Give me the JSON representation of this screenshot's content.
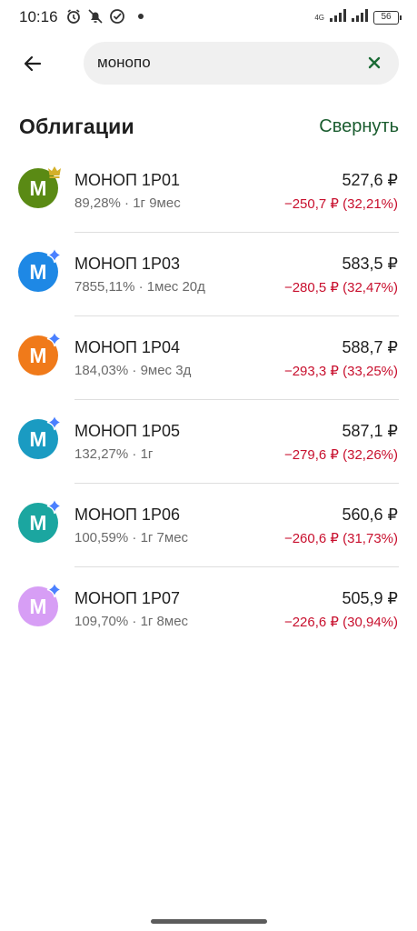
{
  "status_bar": {
    "time": "10:16",
    "network": "4G",
    "battery": "56"
  },
  "search": {
    "value": "монопо"
  },
  "section": {
    "title": "Облигации",
    "collapse_label": "Свернуть"
  },
  "bonds": [
    {
      "name": "МОНОП 1Р01",
      "yield": "89,28%",
      "term": "1г 9мес",
      "price": "527,6 ₽",
      "change": "−250,7 ₽ (32,21%)",
      "avatar_letter": "М",
      "avatar_color": "#5a8a14",
      "badge": "crown-icon",
      "badge_color": "#d4b02a"
    },
    {
      "name": "МОНОП 1Р03",
      "yield": "7855,11%",
      "term": "1мес 20д",
      "price": "583,5 ₽",
      "change": "−280,5 ₽ (32,47%)",
      "avatar_letter": "М",
      "avatar_color": "#1e88e5",
      "badge": "sparkle-icon",
      "badge_color": "#4a80ff"
    },
    {
      "name": "МОНОП 1Р04",
      "yield": "184,03%",
      "term": "9мес 3д",
      "price": "588,7 ₽",
      "change": "−293,3 ₽ (33,25%)",
      "avatar_letter": "М",
      "avatar_color": "#f07a1a",
      "badge": "sparkle-icon",
      "badge_color": "#4a80ff"
    },
    {
      "name": "МОНОП 1Р05",
      "yield": "132,27%",
      "term": "1г",
      "price": "587,1 ₽",
      "change": "−279,6 ₽ (32,26%)",
      "avatar_letter": "М",
      "avatar_color": "#1a9bc2",
      "badge": "sparkle-icon",
      "badge_color": "#4a80ff"
    },
    {
      "name": "МОНОП 1Р06",
      "yield": "100,59%",
      "term": "1г 7мес",
      "price": "560,6 ₽",
      "change": "−260,6 ₽ (31,73%)",
      "avatar_letter": "М",
      "avatar_color": "#1ba6a0",
      "badge": "sparkle-icon",
      "badge_color": "#4a80ff"
    },
    {
      "name": "МОНОП 1Р07",
      "yield": "109,70%",
      "term": "1г 8мес",
      "price": "505,9 ₽",
      "change": "−226,6 ₽ (30,94%)",
      "avatar_letter": "М",
      "avatar_color": "#d79ef5",
      "badge": "sparkle-icon",
      "badge_color": "#4a80ff"
    }
  ],
  "colors": {
    "accent_green": "#1a5c2f",
    "negative_red": "#c8102e",
    "search_bg": "#f0f0f0"
  }
}
